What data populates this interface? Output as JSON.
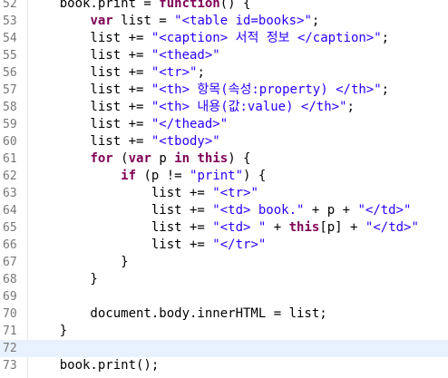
{
  "editor": {
    "current_line": "72",
    "colors": {
      "keyword": "#7f0055",
      "string": "#2a00ff",
      "plain": "#000000",
      "line_number": "#787878",
      "current_line_bg": "#e8f2fe"
    },
    "lines": [
      {
        "num": "52",
        "tokens": [
          {
            "t": "    book.print = ",
            "c": "plain"
          },
          {
            "t": "function",
            "c": "kw"
          },
          {
            "t": "() {",
            "c": "plain"
          }
        ]
      },
      {
        "num": "53",
        "tokens": [
          {
            "t": "        ",
            "c": "plain"
          },
          {
            "t": "var",
            "c": "kw"
          },
          {
            "t": " list = ",
            "c": "plain"
          },
          {
            "t": "\"<table id=books>\"",
            "c": "str"
          },
          {
            "t": ";",
            "c": "plain"
          }
        ]
      },
      {
        "num": "54",
        "tokens": [
          {
            "t": "        list += ",
            "c": "plain"
          },
          {
            "t": "\"<caption> 서적 정보 </caption>\"",
            "c": "str"
          },
          {
            "t": ";",
            "c": "plain"
          }
        ]
      },
      {
        "num": "55",
        "tokens": [
          {
            "t": "        list += ",
            "c": "plain"
          },
          {
            "t": "\"<thead>\"",
            "c": "str"
          }
        ]
      },
      {
        "num": "56",
        "tokens": [
          {
            "t": "        list += ",
            "c": "plain"
          },
          {
            "t": "\"<tr>\"",
            "c": "str"
          },
          {
            "t": ";",
            "c": "plain"
          }
        ]
      },
      {
        "num": "57",
        "tokens": [
          {
            "t": "        list += ",
            "c": "plain"
          },
          {
            "t": "\"<th> 항목(속성:property) </th>\"",
            "c": "str"
          },
          {
            "t": ";",
            "c": "plain"
          }
        ]
      },
      {
        "num": "58",
        "tokens": [
          {
            "t": "        list += ",
            "c": "plain"
          },
          {
            "t": "\"<th> 내용(값:value) </th>\"",
            "c": "str"
          },
          {
            "t": ";",
            "c": "plain"
          }
        ]
      },
      {
        "num": "59",
        "tokens": [
          {
            "t": "        list += ",
            "c": "plain"
          },
          {
            "t": "\"</thead>\"",
            "c": "str"
          }
        ]
      },
      {
        "num": "60",
        "tokens": [
          {
            "t": "        list += ",
            "c": "plain"
          },
          {
            "t": "\"<tbody>\"",
            "c": "str"
          }
        ]
      },
      {
        "num": "61",
        "tokens": [
          {
            "t": "        ",
            "c": "plain"
          },
          {
            "t": "for",
            "c": "kw"
          },
          {
            "t": " (",
            "c": "plain"
          },
          {
            "t": "var",
            "c": "kw"
          },
          {
            "t": " p ",
            "c": "plain"
          },
          {
            "t": "in",
            "c": "kw"
          },
          {
            "t": " ",
            "c": "plain"
          },
          {
            "t": "this",
            "c": "kw"
          },
          {
            "t": ") {",
            "c": "plain"
          }
        ]
      },
      {
        "num": "62",
        "tokens": [
          {
            "t": "            ",
            "c": "plain"
          },
          {
            "t": "if",
            "c": "kw"
          },
          {
            "t": " (p != ",
            "c": "plain"
          },
          {
            "t": "\"print\"",
            "c": "str"
          },
          {
            "t": ") {",
            "c": "plain"
          }
        ]
      },
      {
        "num": "63",
        "tokens": [
          {
            "t": "                list += ",
            "c": "plain"
          },
          {
            "t": "\"<tr>\"",
            "c": "str"
          }
        ]
      },
      {
        "num": "64",
        "tokens": [
          {
            "t": "                list += ",
            "c": "plain"
          },
          {
            "t": "\"<td> book.\"",
            "c": "str"
          },
          {
            "t": " + p + ",
            "c": "plain"
          },
          {
            "t": "\"</td>\"",
            "c": "str"
          }
        ]
      },
      {
        "num": "65",
        "tokens": [
          {
            "t": "                list += ",
            "c": "plain"
          },
          {
            "t": "\"<td> \"",
            "c": "str"
          },
          {
            "t": " + ",
            "c": "plain"
          },
          {
            "t": "this",
            "c": "kw"
          },
          {
            "t": "[p] + ",
            "c": "plain"
          },
          {
            "t": "\"</td>\"",
            "c": "str"
          }
        ]
      },
      {
        "num": "66",
        "tokens": [
          {
            "t": "                list += ",
            "c": "plain"
          },
          {
            "t": "\"</tr>\"",
            "c": "str"
          }
        ]
      },
      {
        "num": "67",
        "tokens": [
          {
            "t": "            }",
            "c": "plain"
          }
        ]
      },
      {
        "num": "68",
        "tokens": [
          {
            "t": "        }",
            "c": "plain"
          }
        ]
      },
      {
        "num": "69",
        "tokens": [
          {
            "t": "",
            "c": "plain"
          }
        ]
      },
      {
        "num": "70",
        "tokens": [
          {
            "t": "        document.body.innerHTML = list;",
            "c": "plain"
          }
        ]
      },
      {
        "num": "71",
        "tokens": [
          {
            "t": "    }",
            "c": "plain"
          }
        ]
      },
      {
        "num": "72",
        "tokens": [
          {
            "t": "",
            "c": "plain"
          }
        ]
      },
      {
        "num": "73",
        "tokens": [
          {
            "t": "    book.print();",
            "c": "plain"
          }
        ]
      }
    ]
  }
}
